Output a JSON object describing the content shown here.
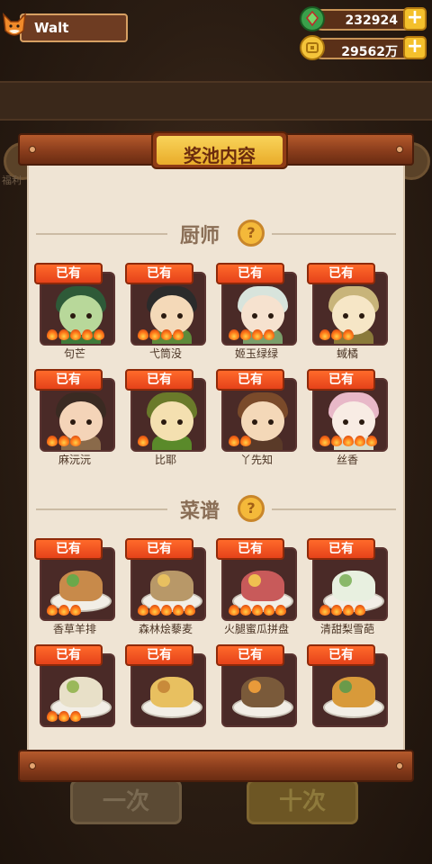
{
  "player": {
    "name": "Walt"
  },
  "resources": {
    "gems": {
      "value": "232924",
      "icon": "green-gem-icon"
    },
    "coins": {
      "value": "29562万",
      "icon": "coin-icon"
    }
  },
  "dialog": {
    "title": "奖池内容"
  },
  "background": {
    "side_label": "福利",
    "bottom_left": "一次",
    "bottom_right": "十次"
  },
  "sections": {
    "chefs": {
      "title": "厨师",
      "help": "?",
      "items": [
        {
          "name": "句芒",
          "owned_label": "已有",
          "flames": 5,
          "hair": "#2e5a38",
          "skin": "#b8d89a",
          "body": "#3f7a3a"
        },
        {
          "name": "弋筒没",
          "owned_label": "已有",
          "flames": 4,
          "hair": "#2b2b2b",
          "skin": "#f4d9b8",
          "body": "#5e8a3a"
        },
        {
          "name": "姬玉绿绿",
          "owned_label": "已有",
          "flames": 4,
          "hair": "#d8e4dc",
          "skin": "#f6e2cf",
          "body": "#7a9e6a"
        },
        {
          "name": "蜮橘",
          "owned_label": "已有",
          "flames": 3,
          "hair": "#c8b47a",
          "skin": "#f6e6c6",
          "body": "#8a7a3a"
        },
        {
          "name": "麻沅沅",
          "owned_label": "已有",
          "flames": 3,
          "hair": "#3a2a22",
          "skin": "#f4d4b8",
          "body": "#8a6a4a"
        },
        {
          "name": "比耶",
          "owned_label": "已有",
          "flames": 1,
          "hair": "#6a7a2a",
          "skin": "#f4e0b0",
          "body": "#5a8a2a"
        },
        {
          "name": "丫先知",
          "owned_label": "已有",
          "flames": 2,
          "hair": "#7a4a2a",
          "skin": "#f4d8b8",
          "body": "#5a3a28"
        },
        {
          "name": "丝香",
          "owned_label": "已有",
          "flames": 5,
          "hair": "#e8b8c8",
          "skin": "#f8ece4",
          "body": "#d8dcc8"
        }
      ]
    },
    "recipes": {
      "title": "菜谱",
      "help": "?",
      "items": [
        {
          "name": "香草羊排",
          "owned_label": "已有",
          "flames": 3,
          "food": "#c88a4a",
          "accent": "#6aa84a"
        },
        {
          "name": "森林烩藜麦",
          "owned_label": "已有",
          "flames": 5,
          "food": "#b89868",
          "accent": "#e8c060"
        },
        {
          "name": "火腿蜜瓜拼盘",
          "owned_label": "已有",
          "flames": 5,
          "food": "#c85a5a",
          "accent": "#f0c050"
        },
        {
          "name": "清甜梨雪葩",
          "owned_label": "已有",
          "flames": 4,
          "food": "#e8f0e0",
          "accent": "#8ab86a"
        },
        {
          "name": "",
          "owned_label": "已有",
          "flames": 3,
          "food": "#e8e0c8",
          "accent": "#9ab85a"
        },
        {
          "name": "",
          "owned_label": "已有",
          "flames": 0,
          "food": "#e8c060",
          "accent": "#c88a3a"
        },
        {
          "name": "",
          "owned_label": "已有",
          "flames": 0,
          "food": "#7a5a3a",
          "accent": "#e89a3a"
        },
        {
          "name": "",
          "owned_label": "已有",
          "flames": 0,
          "food": "#d89a3a",
          "accent": "#6a9a4a"
        }
      ]
    }
  }
}
